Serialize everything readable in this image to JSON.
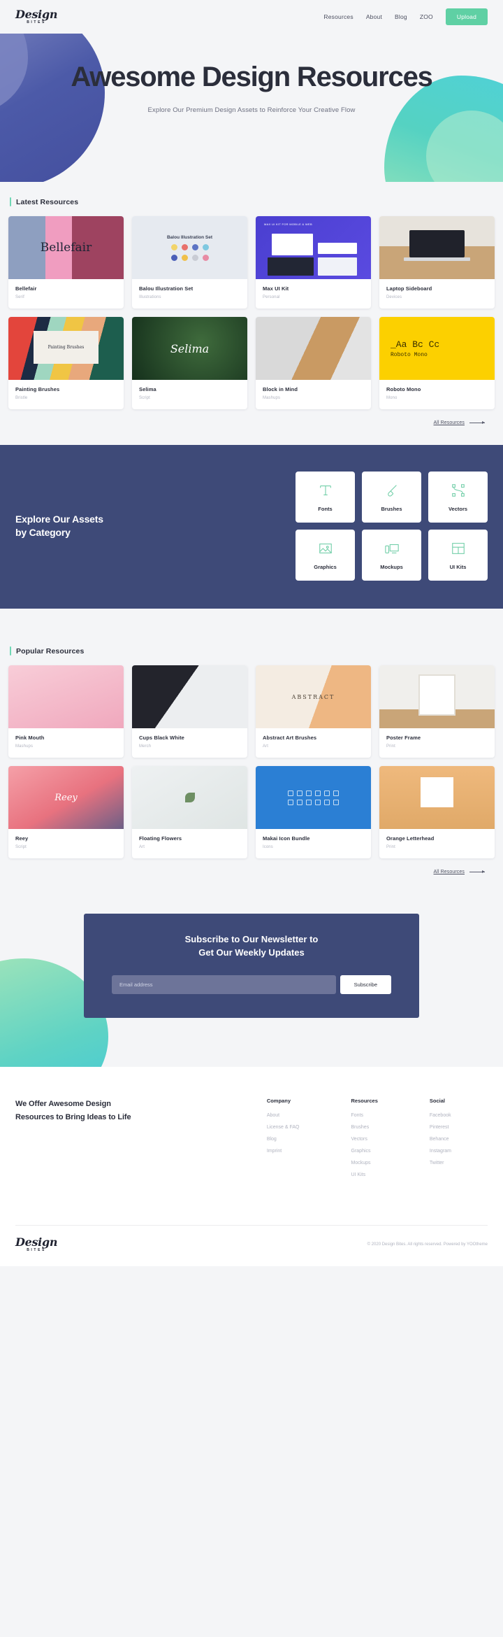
{
  "header": {
    "logo_main": "Design",
    "logo_sub": "BITES",
    "nav": [
      {
        "label": "Resources"
      },
      {
        "label": "About"
      },
      {
        "label": "Blog"
      },
      {
        "label": "ZOO"
      }
    ],
    "upload_label": "Upload"
  },
  "hero": {
    "title": "Awesome Design Resources",
    "subtitle": "Explore Our Premium Design Assets to Reinforce Your Creative Flow"
  },
  "latest": {
    "section_title": "Latest Resources",
    "all_link": "All Resources",
    "cards": [
      {
        "title": "Bellefair",
        "category": "Serif",
        "thumb": "t-bellefair"
      },
      {
        "title": "Balou Illustration Set",
        "category": "Illustrations",
        "thumb": "t-balou"
      },
      {
        "title": "Max UI Kit",
        "category": "Personal",
        "thumb": "t-max"
      },
      {
        "title": "Laptop Sideboard",
        "category": "Devices",
        "thumb": "t-laptop"
      },
      {
        "title": "Painting Brushes",
        "category": "Bristle",
        "thumb": "t-brushes"
      },
      {
        "title": "Selima",
        "category": "Script",
        "thumb": "t-selima"
      },
      {
        "title": "Block in Mind",
        "category": "Mashups",
        "thumb": "t-block"
      },
      {
        "title": "Roboto Mono",
        "category": "Mono",
        "thumb": "t-roboto"
      }
    ],
    "thumb_text": {
      "bellefair": "Bellefair",
      "balou": "Balou Illustration Set",
      "max_caption": "MAX UI KIT FOR MOBILE & WEB",
      "brushes_label": "Painting Brushes",
      "selima": "Selima",
      "roboto_big": "_Aa Bc Cc",
      "roboto_small": "Roboto Mono",
      "abstract": "ABSTRACT"
    }
  },
  "categories": {
    "heading_line1": "Explore Our Assets",
    "heading_line2": "by Category",
    "items": [
      {
        "label": "Fonts",
        "icon": "type-icon"
      },
      {
        "label": "Brushes",
        "icon": "brush-icon"
      },
      {
        "label": "Vectors",
        "icon": "pen-tool-icon"
      },
      {
        "label": "Graphics",
        "icon": "image-icon"
      },
      {
        "label": "Mockups",
        "icon": "devices-icon"
      },
      {
        "label": "UI Kits",
        "icon": "layout-icon"
      }
    ]
  },
  "popular": {
    "section_title": "Popular Resources",
    "all_link": "All Resources",
    "cards": [
      {
        "title": "Pink Mouth",
        "category": "Mashups",
        "thumb": "t-pink"
      },
      {
        "title": "Cups Black White",
        "category": "Merch",
        "thumb": "t-cups"
      },
      {
        "title": "Abstract Art Brushes",
        "category": "Art",
        "thumb": "t-abstract"
      },
      {
        "title": "Poster Frame",
        "category": "Print",
        "thumb": "t-poster"
      },
      {
        "title": "Reey",
        "category": "Script",
        "thumb": "t-reey"
      },
      {
        "title": "Floating Flowers",
        "category": "Art",
        "thumb": "t-flowers"
      },
      {
        "title": "Makai Icon Bundle",
        "category": "Icons",
        "thumb": "t-makai"
      },
      {
        "title": "Orange Letterhead",
        "category": "Print",
        "thumb": "t-orange"
      }
    ]
  },
  "newsletter": {
    "title_line1": "Subscribe to Our Newsletter to",
    "title_line2": "Get Our Weekly Updates",
    "email_placeholder": "Email address",
    "email_value": "",
    "subscribe_label": "Subscribe"
  },
  "footer": {
    "tagline_line1": "We Offer Awesome Design",
    "tagline_line2": "Resources to Bring Ideas to Life",
    "columns": [
      {
        "title": "Company",
        "links": [
          "About",
          "License & FAQ",
          "Blog",
          "Imprint"
        ]
      },
      {
        "title": "Resources",
        "links": [
          "Fonts",
          "Brushes",
          "Vectors",
          "Graphics",
          "Mockups",
          "UI Kits"
        ]
      },
      {
        "title": "Social",
        "links": [
          "Facebook",
          "Pinterest",
          "Behance",
          "Instagram",
          "Twitter"
        ]
      }
    ],
    "logo_main": "Design",
    "logo_sub": "BITES",
    "copyright": "© 2020 Design Bites. All rights reserved. Powered by YOOtheme"
  },
  "colors": {
    "accent_green": "#5fd0a4",
    "navy": "#3e4a78",
    "page_bg": "#f4f5f7",
    "text_dark": "#2b2e3b",
    "muted": "#b0b3bf"
  }
}
